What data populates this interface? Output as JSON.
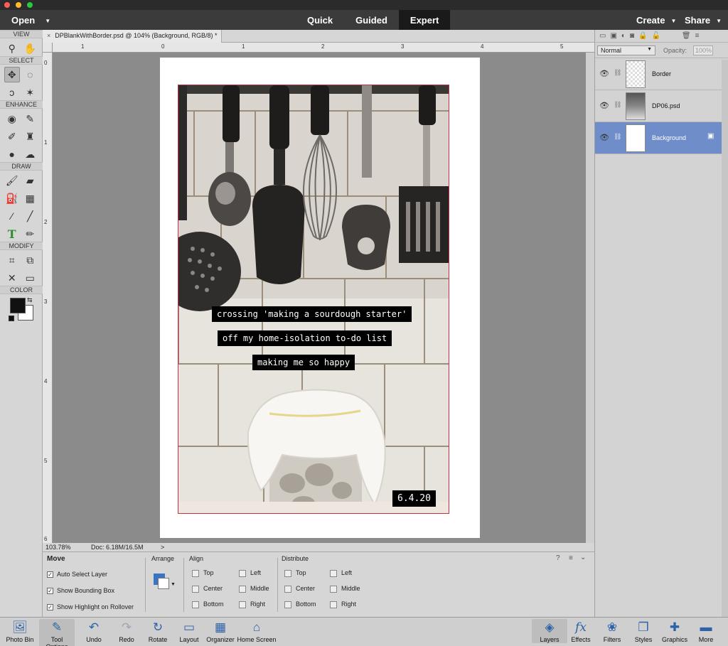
{
  "menubar": {
    "open_label": "Open",
    "modes": [
      "Quick",
      "Guided",
      "Expert"
    ],
    "create_label": "Create",
    "share_label": "Share"
  },
  "toolbox": {
    "sections": {
      "view": "VIEW",
      "select": "SELECT",
      "enhance": "ENHANCE",
      "draw": "DRAW",
      "modify": "MODIFY",
      "color": "COLOR"
    },
    "icons": [
      "zoom-icon",
      "hand-icon",
      "move-icon",
      "marquee-icon",
      "lasso-icon",
      "magic-wand-icon",
      "red-eye-icon",
      "spot-healing-icon",
      "smart-brush-icon",
      "clone-stamp-icon",
      "blur-icon",
      "sponge-icon",
      "brush-icon",
      "eraser-icon",
      "paint-bucket-icon",
      "gradient-icon",
      "eyedropper-icon",
      "line-icon",
      "type-icon",
      "pencil-icon",
      "crop-icon",
      "recompose-icon",
      "content-aware-move-icon",
      "straighten-icon"
    ],
    "foreground_color": "#111111",
    "background_color": "#ffffff"
  },
  "document": {
    "tab_title": "DPBlankWithBorder.psd @ 104% (Background, RGB/8) *",
    "ruler_h": [
      "1",
      "0",
      "1",
      "2",
      "3",
      "4",
      "5"
    ],
    "ruler_v": [
      "0",
      "1",
      "2",
      "3",
      "4",
      "5",
      "6"
    ],
    "captions": [
      "crossing 'making a sourdough starter'",
      "off my home-isolation to-do list",
      "making me so happy"
    ],
    "date": "6.4.20"
  },
  "status": {
    "zoom": "103.78%",
    "doc": "Doc: 6.18M/16.5M",
    "arrow": ">"
  },
  "layers_panel": {
    "blend_mode": "Normal",
    "opacity_label": "Opacity:",
    "opacity_value": "100%",
    "layers": [
      {
        "name": "Border",
        "selected": false
      },
      {
        "name": "DP06.psd",
        "selected": false
      },
      {
        "name": "Background",
        "selected": true
      }
    ]
  },
  "tool_options": {
    "tool_name": "Move",
    "checkboxes": [
      "Auto Select Layer",
      "Show Bounding Box",
      "Show Highlight on Rollover"
    ],
    "arrange_label": "Arrange",
    "align_label": "Align",
    "align_items": [
      "Top",
      "Center",
      "Bottom",
      "Left",
      "Middle",
      "Right"
    ],
    "distribute_label": "Distribute",
    "distribute_items": [
      "Top",
      "Center",
      "Bottom",
      "Left",
      "Middle",
      "Right"
    ]
  },
  "taskbar": {
    "left": [
      "Photo Bin",
      "Tool Options",
      "Undo",
      "Redo",
      "Rotate",
      "Layout",
      "Organizer",
      "Home Screen"
    ],
    "right": [
      "Layers",
      "Effects",
      "Filters",
      "Styles",
      "Graphics",
      "More"
    ]
  },
  "colors": {
    "accent": "#2e62a8",
    "selected_layer": "#6f8ec9",
    "border_red": "#c3304a"
  }
}
